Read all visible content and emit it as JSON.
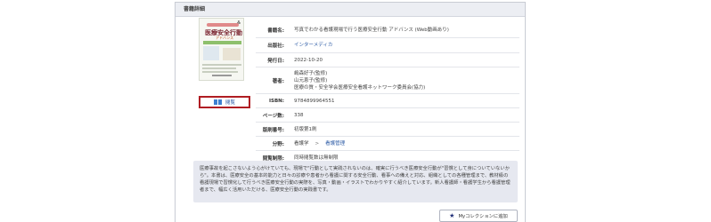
{
  "panel": {
    "header": "書籍詳細"
  },
  "cover": {
    "publisher_mark": "⁂",
    "title": "医療安全行動",
    "subtitle": "アドバンス"
  },
  "viewer_button": {
    "icon": "book-icon",
    "label": "閲覧"
  },
  "details": {
    "rows": [
      {
        "key": "書籍名:",
        "value": "写真でわかる看護現場で行う医療安全行動 アドバンス (Web動画あり)"
      },
      {
        "key": "出版社:",
        "value": "インターメディカ",
        "link": true
      },
      {
        "key": "発行日:",
        "value": "2022-10-20"
      },
      {
        "key": "著者:",
        "lines": [
          "嶋森好子(監修)",
          "山元恵子(監修)",
          "医療の質・安全学会医療安全看護ネットワーク委員会(協力)"
        ]
      },
      {
        "key": "ISBN:",
        "value": "9784899964551"
      },
      {
        "key": "ページ数:",
        "value": "338"
      },
      {
        "key": "版刷番号:",
        "value": "初版第1刷"
      },
      {
        "key": "分野:",
        "value": "看護学",
        "separator": ">",
        "value2": "看護管理"
      },
      {
        "key": "閲覧制限:",
        "value": "同時閲覧数は無制限"
      }
    ]
  },
  "description": "医療事故を起こさないよう心がけていても、現場で\"行動として実践されないのは、確実に行うべき医療安全行動が\"習慣として身についていないから\"。本書は、医療安全の基本的能力と日々の診療や患者から看護に関する安全行動、看事への備えと対応、組織としての各種管理まで、教材級の看護現場で習慣化して行うべき医療安全行動の実際を、写真・動画・イラストでわかりやすく紹介しています。新人看護師・看護学生から看護管理者まで、幅広く活用いただける、医療安全行動の実践書です。",
  "add_button": {
    "icon": "star-icon",
    "label": "Myコレクションに追加"
  },
  "colors": {
    "accent_red": "#b01d23",
    "link_blue": "#2b5aa5",
    "description_bg": "#e6e8f0"
  }
}
